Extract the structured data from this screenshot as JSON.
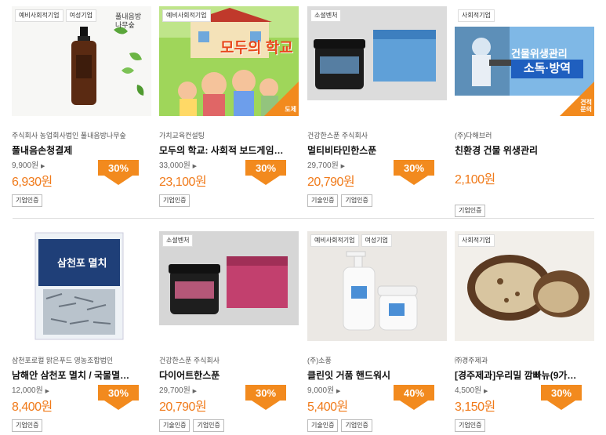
{
  "products": [
    {
      "badges": [
        "예비사회적기업",
        "여성기업"
      ],
      "image": "spray-bottle-photo",
      "image_text": "풀내음방나무숲",
      "seller": "주식회사 농업회사법인 풀내음방나무숲",
      "name": "풀내음손청결제",
      "orig_price": "9,900원",
      "sale_price": "6,930원",
      "discount": "30%",
      "certs": [
        "기업인증"
      ]
    },
    {
      "badges": [
        "예비사회적기업"
      ],
      "image": "board-game-cover",
      "image_text": "모두의 학교",
      "corner": "도제",
      "seller": "가치교육컨설팅",
      "name": "모두의 학교: 사회적 보드게임…",
      "orig_price": "33,000원",
      "sale_price": "23,100원",
      "discount": "30%",
      "certs": [
        "기업인증"
      ]
    },
    {
      "badges": [
        "소셜벤처"
      ],
      "image": "supplement-jar-box",
      "seller": "건강한스푼 주식회사",
      "name": "멀티비타민한스푼",
      "orig_price": "29,700원",
      "sale_price": "20,790원",
      "discount": "30%",
      "certs": [
        "기술인증",
        "기업인증"
      ]
    },
    {
      "badges": [
        "사회적기업"
      ],
      "image": "disinfection-banner",
      "image_text_1": "건물위생관리",
      "image_text_2": "소독·방역",
      "corner": "견적\n문의",
      "seller": "(주)다해브러",
      "name": "친환경 건물 위생관리",
      "orig_price": "",
      "sale_price": "2,100원",
      "discount": "",
      "certs": [
        "기업인증"
      ]
    },
    {
      "badges": [],
      "image": "anchovy-package",
      "image_text": "삼천포 멸치",
      "seller": "삼천포로컬 맑은푸드 영농조합법인",
      "name": "남해안 삼천포 멸치 / 국물멸…",
      "orig_price": "12,000원",
      "sale_price": "8,400원",
      "discount": "30%",
      "certs": [
        "기업인증"
      ]
    },
    {
      "badges": [
        "소셜벤처"
      ],
      "image": "diet-jar-box",
      "seller": "건강한스푼 주식회사",
      "name": "다이어트한스푼",
      "orig_price": "29,700원",
      "sale_price": "20,790원",
      "discount": "30%",
      "certs": [
        "기술인증",
        "기업인증"
      ]
    },
    {
      "badges": [
        "예비사회적기업",
        "여성기업"
      ],
      "image": "hand-wash-bottles",
      "seller": "(주)소풍",
      "name": "클린잇 거품 핸드워시",
      "orig_price": "9,000원",
      "sale_price": "5,400원",
      "discount": "40%",
      "certs": [
        "기술인증",
        "기업인증"
      ]
    },
    {
      "badges": [
        "사회적기업"
      ],
      "image": "bread-photo",
      "seller": "㈜경주제과",
      "name": "[경주제과]우리밀 깜빠뉴(9가…",
      "orig_price": "4,500원",
      "sale_price": "3,150원",
      "discount": "30%",
      "certs": [
        "기업인증"
      ]
    }
  ],
  "colors": {
    "accent": "#f28a1e",
    "sale_text": "#f07a1a"
  }
}
